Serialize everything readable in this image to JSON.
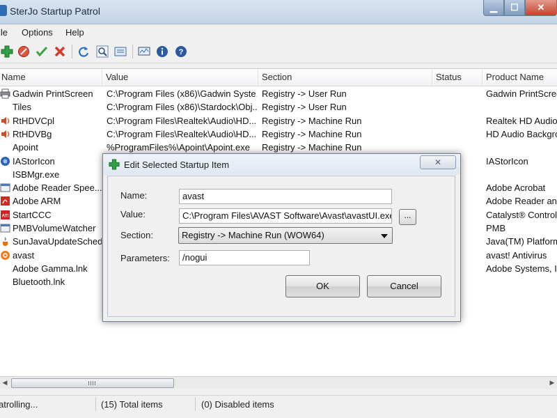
{
  "window": {
    "title": "SterJo Startup Patrol",
    "controls": [
      "▁",
      "☐",
      "✕"
    ]
  },
  "menu": [
    "File",
    "Options",
    "Help"
  ],
  "columns": [
    "Name",
    "Value",
    "Section",
    "Status",
    "Product Name"
  ],
  "rows": [
    {
      "name": "Gadwin PrintScreen",
      "value": "C:\\Program Files (x86)\\Gadwin Syste...",
      "section": "Registry -> User Run",
      "status": "",
      "product": "Gadwin PrintScreen"
    },
    {
      "name": "Tiles",
      "value": "C:\\Program Files (x86)\\Stardock\\Obj...",
      "section": "Registry -> User Run",
      "status": "",
      "product": ""
    },
    {
      "name": "RtHDVCpl",
      "value": "C:\\Program Files\\Realtek\\Audio\\HD...",
      "section": "Registry -> Machine Run",
      "status": "",
      "product": "Realtek HD Audio M"
    },
    {
      "name": "RtHDVBg",
      "value": "C:\\Program Files\\Realtek\\Audio\\HD...",
      "section": "Registry -> Machine Run",
      "status": "",
      "product": "HD Audio Backgrou"
    },
    {
      "name": "Apoint",
      "value": "%ProgramFiles%\\Apoint\\Apoint.exe",
      "section": "Registry -> Machine Run",
      "status": "",
      "product": ""
    },
    {
      "name": "IAStorIcon",
      "value": "",
      "section": "",
      "status": "",
      "product": "IAStorIcon"
    },
    {
      "name": "ISBMgr.exe",
      "value": "",
      "section": "",
      "status": "",
      "product": ""
    },
    {
      "name": "Adobe Reader Spee...",
      "value": "",
      "section": "",
      "status": "",
      "product": "Adobe Acrobat"
    },
    {
      "name": "Adobe ARM",
      "value": "",
      "section": "",
      "status": "",
      "product": "Adobe Reader and"
    },
    {
      "name": "StartCCC",
      "value": "",
      "section": "",
      "status": "",
      "product": "Catalyst® Control C"
    },
    {
      "name": "PMBVolumeWatcher",
      "value": "",
      "section": "",
      "status": "",
      "product": "PMB"
    },
    {
      "name": "SunJavaUpdateSched",
      "value": "",
      "section": "",
      "status": "",
      "product": "Java(TM) Platform S"
    },
    {
      "name": "avast",
      "value": "",
      "section": "",
      "status": "",
      "product": "avast! Antivirus"
    },
    {
      "name": "Adobe Gamma.lnk",
      "value": "",
      "section": "",
      "status": "",
      "product": "Adobe Systems, Inc"
    },
    {
      "name": "Bluetooth.lnk",
      "value": "",
      "section": "",
      "status": "",
      "product": ""
    }
  ],
  "status": {
    "left": "atrolling...",
    "total": "(15) Total items",
    "disabled": "(0) Disabled items"
  },
  "dialog": {
    "title": "Edit Selected Startup Item",
    "close": "✕",
    "name_label": "Name:",
    "name_value": "avast",
    "value_label": "Value:",
    "value_value": "C:\\Program Files\\AVAST Software\\Avast\\avastUI.exe",
    "browse_label": "...",
    "section_label": "Section:",
    "section_value": "Registry -> Machine Run (WOW64)",
    "parameters_label": "Parameters:",
    "parameters_value": "/nogui",
    "ok_label": "OK",
    "cancel_label": "Cancel"
  },
  "icons": {
    "toolbar": [
      "add-icon",
      "disable-icon",
      "enable-icon",
      "delete-icon",
      "refresh-icon",
      "search-icon",
      "export-icon",
      "monitor-icon",
      "info-icon",
      "help-icon"
    ],
    "rows": [
      "printer",
      "blank",
      "speaker",
      "speaker",
      "blank",
      "shield",
      "blank",
      "doc",
      "pdf",
      "ati",
      "doc",
      "java",
      "avast",
      "blank",
      "blank"
    ]
  },
  "colors": {
    "add": "#2ea043",
    "delete": "#d83a2a",
    "info": "#2c5aa0",
    "titlebar": "#c3d3e6"
  }
}
